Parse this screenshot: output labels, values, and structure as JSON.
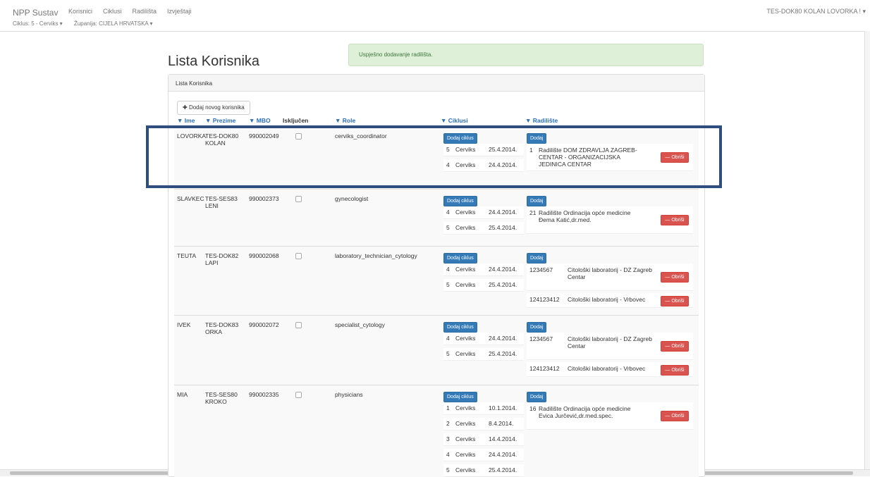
{
  "nav": {
    "brand": "NPP Sustav",
    "links": [
      "Korisnici",
      "Ciklusi",
      "Radilišta",
      "Izvještaji"
    ],
    "cycle": "Ciklus: 5 - Cerviks ▾",
    "county": "Županija: CIJELA HRVATSKA ▾",
    "user": "TES-DOK80 KOLAN LOVORKA ! ▾"
  },
  "page": {
    "title": "Lista Korisnika",
    "alert": "Uspješno dodavanje radilišta.",
    "panel_title": "Lista Korisnika",
    "add_user_label": "Dodaj novog korisnika",
    "headers": [
      "▼ Ime",
      "▼ Prezime",
      "▼ MBO",
      "Isključen",
      "▼ Role",
      "▼ Ciklusi",
      "▼ Radilište"
    ],
    "add_cycle_label": "Dodaj ciklus",
    "add_site_label": "Dodaj",
    "delete_label": "Obriši",
    "delete_icon": "minus-icon",
    "plus_icon": "plus-icon"
  },
  "users": [
    {
      "ime": "LOVORKA",
      "prezime1": "TES-DOK80",
      "prezime2": "KOLAN",
      "mbo": "990002049",
      "role": "cerviks_coordinator",
      "cycles": [
        [
          "5",
          "Cerviks",
          "25.4.2014."
        ],
        [
          "4",
          "Cerviks",
          "24.4.2014."
        ]
      ],
      "sites": [
        {
          "num": "1",
          "name": "Radilište DOM ZDRAVLJA ZAGREB-CENTAR - ORGANIZACIJSKA JEDINICA CENTAR"
        }
      ]
    },
    {
      "ime": "SLAVKEC",
      "prezime1": "TES-SES83",
      "prezime2": "LENI",
      "mbo": "990002373",
      "role": "gynecologist",
      "cycles": [
        [
          "4",
          "Cerviks",
          "24.4.2014."
        ],
        [
          "5",
          "Cerviks",
          "25.4.2014."
        ]
      ],
      "sites": [
        {
          "num": "21",
          "name": "Radilište Ordinacija opće medicine Đema Katić,dr.med."
        }
      ]
    },
    {
      "ime": "TEUTA",
      "prezime1": "TES-DOK82",
      "prezime2": "LAPI",
      "mbo": "990002068",
      "role": "laboratory_technician_cytology",
      "cycles": [
        [
          "4",
          "Cerviks",
          "24.4.2014."
        ],
        [
          "5",
          "Cerviks",
          "25.4.2014."
        ]
      ],
      "sites": [
        {
          "num": "1234567",
          "name": "Citološki laboratorij - DZ Zagreb Centar"
        },
        {
          "num": "124123412",
          "name": "Citološki laboratorij - Vrbovec"
        }
      ]
    },
    {
      "ime": "IVEK",
      "prezime1": "TES-DOK83",
      "prezime2": "ORKA",
      "mbo": "990002072",
      "role": "specialist_cytology",
      "cycles": [
        [
          "4",
          "Cerviks",
          "24.4.2014."
        ],
        [
          "5",
          "Cerviks",
          "25.4.2014."
        ]
      ],
      "sites": [
        {
          "num": "1234567",
          "name": "Citološki laboratorij - DZ Zagreb Centar"
        },
        {
          "num": "124123412",
          "name": "Citološki laboratorij - Vrbovec"
        }
      ]
    },
    {
      "ime": "MIA",
      "prezime1": "TES-SES80",
      "prezime2": "KROKO",
      "mbo": "990002335",
      "role": "physicians",
      "cycles": [
        [
          "1",
          "Cerviks",
          "10.1.2014."
        ],
        [
          "2",
          "Cerviks",
          "8.4.2014."
        ],
        [
          "3",
          "Cerviks",
          "14.4.2014."
        ],
        [
          "4",
          "Cerviks",
          "24.4.2014."
        ],
        [
          "5",
          "Cerviks",
          "25.4.2014."
        ]
      ],
      "sites": [
        {
          "num": "16",
          "name": "Radilište Ordinacija opće medicine Evica Jurčević,dr.med.spec."
        }
      ]
    }
  ]
}
